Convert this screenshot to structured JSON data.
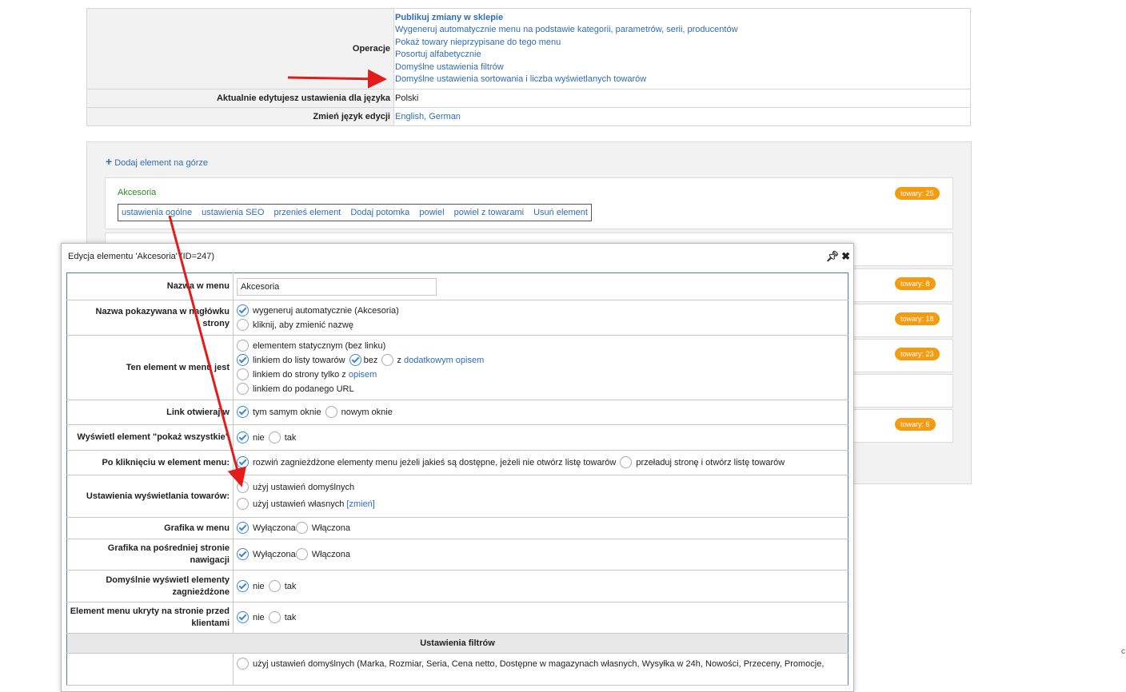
{
  "top": {
    "operations_label": "Operacje",
    "operations": [
      "Publikuj zmiany w sklepie",
      "Wygeneruj automatycznie menu na podstawie kategorii, parametrów, serii, producentów",
      "Pokaż towary nieprzypisane do tego menu",
      "Posortuj alfabetycznie",
      "Domyślne ustawienia filtrów",
      "Domyślne ustawienia sortowania i liczba wyświetlanych towarów"
    ],
    "language_label": "Aktualnie edytujesz ustawienia dla języka",
    "language_value": "Polski",
    "change_language_label": "Zmień język edycji",
    "change_language_links": "English, German"
  },
  "menu": {
    "add_top": "Dodaj element na górze",
    "first_item": {
      "name": "Akcesoria",
      "badge": "towary: 25",
      "actions": [
        "ustawienia ogólne",
        "ustawienia SEO",
        "przenieś element",
        "Dodaj potomka",
        "powiel",
        "powiel z towarami",
        "Usuń element"
      ]
    },
    "other_badges": [
      "towary: 8",
      "towary: 18",
      "towary: 23",
      "towary: 6"
    ]
  },
  "dialog": {
    "title": "Edycja elementu 'Akcesoria' (ID=247)",
    "icons": [
      "pin-icon",
      "close-icon"
    ],
    "name_label": "Nazwa w menu",
    "name_value": "Akcesoria",
    "header_name_label": "Nazwa pokazywana w nagłówku strony",
    "header_name_opt1": "wygeneruj automatycznie (Akcesoria)",
    "header_name_opt2": "kliknij, aby zmienić nazwę",
    "element_type_label": "Ten element w menu jest",
    "element_type_opt1": "elementem statycznym (bez linku)",
    "element_type_opt2": "linkiem do listy towarów",
    "element_type_opt2_bez": "bez",
    "element_type_opt2_z": "z",
    "element_type_opt2_link": "dodatkowym opisem",
    "element_type_opt3": "linkiem do strony tylko z",
    "element_type_opt3_link": "opisem",
    "element_type_opt4": "linkiem do podanego URL",
    "link_open_label": "Link otwieraj w",
    "link_open_opt1": "tym samym oknie",
    "link_open_opt2": "nowym oknie",
    "show_all_label": "Wyświetl element \"pokaż wszystkie\"",
    "show_all_opt1": "nie",
    "show_all_opt2": "tak",
    "on_click_label": "Po kliknięciu w element menu:",
    "on_click_opt1": "rozwiń zagnieżdżone elementy menu jeżeli jakieś są dostępne, jeżeli nie otwórz listę towarów",
    "on_click_opt2": "przeładuj stronę i otwórz listę towarów",
    "display_settings_label": "Ustawienia wyświetlania towarów:",
    "display_settings_opt1": "użyj ustawień domyślnych",
    "display_settings_opt2": "użyj ustawień własnych",
    "display_settings_change": "[zmień]",
    "graphic_menu_label": "Grafika w menu",
    "graphic_nav_label": "Grafika na pośredniej stronie nawigacji",
    "off_label": "Wyłączona",
    "on_label": "Włączona",
    "expand_default_label": "Domyślnie wyświetl elementy zagnieżdżone",
    "hidden_label": "Element menu ukryty na stronie przed klientami",
    "no": "nie",
    "yes": "tak",
    "filters_section": "Ustawienia filtrów",
    "filters_opt1": "użyj ustawień domyślnych (Marka, Rozmiar, Seria, Cena netto, Dostępne w magazynach własnych, Wysyłka w 24h, Nowości, Przeceny, Promocje,"
  },
  "corner_char": "c",
  "colors": {
    "link": "#2f6db5",
    "badge": "#f39c12",
    "arrow": "#e31b1b",
    "dialog_border": "#4b7db8",
    "item_name": "#2a8a2a"
  }
}
